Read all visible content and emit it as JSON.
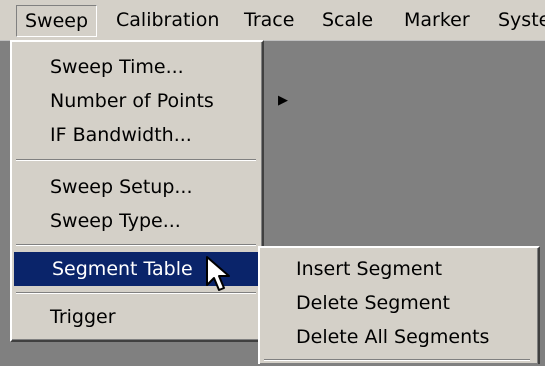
{
  "menubar": {
    "items": [
      {
        "label": "Sweep"
      },
      {
        "label": "Calibration"
      },
      {
        "label": "Trace"
      },
      {
        "label": "Scale"
      },
      {
        "label": "Marker"
      },
      {
        "label": "Syste"
      }
    ]
  },
  "sweep_menu": {
    "items": [
      {
        "label": "Sweep Time...",
        "arrow": ""
      },
      {
        "label": "Number of Points",
        "arrow": "▶"
      },
      {
        "label": "IF Bandwidth...",
        "arrow": ""
      },
      {
        "label": "Sweep Setup...",
        "arrow": ""
      },
      {
        "label": "Sweep Type...",
        "arrow": ""
      },
      {
        "label": "Segment Table",
        "arrow": "▶"
      },
      {
        "label": "Trigger",
        "arrow": "▶"
      }
    ]
  },
  "segment_submenu": {
    "items": [
      {
        "label": "Insert Segment"
      },
      {
        "label": "Delete Segment"
      },
      {
        "label": "Delete All Segments"
      }
    ]
  },
  "colors": {
    "menu_bg": "#d4d0c8",
    "highlight": "#0a246a",
    "workspace": "#808080"
  },
  "icons": [
    "chevron-right-icon",
    "mouse-pointer-icon"
  ]
}
